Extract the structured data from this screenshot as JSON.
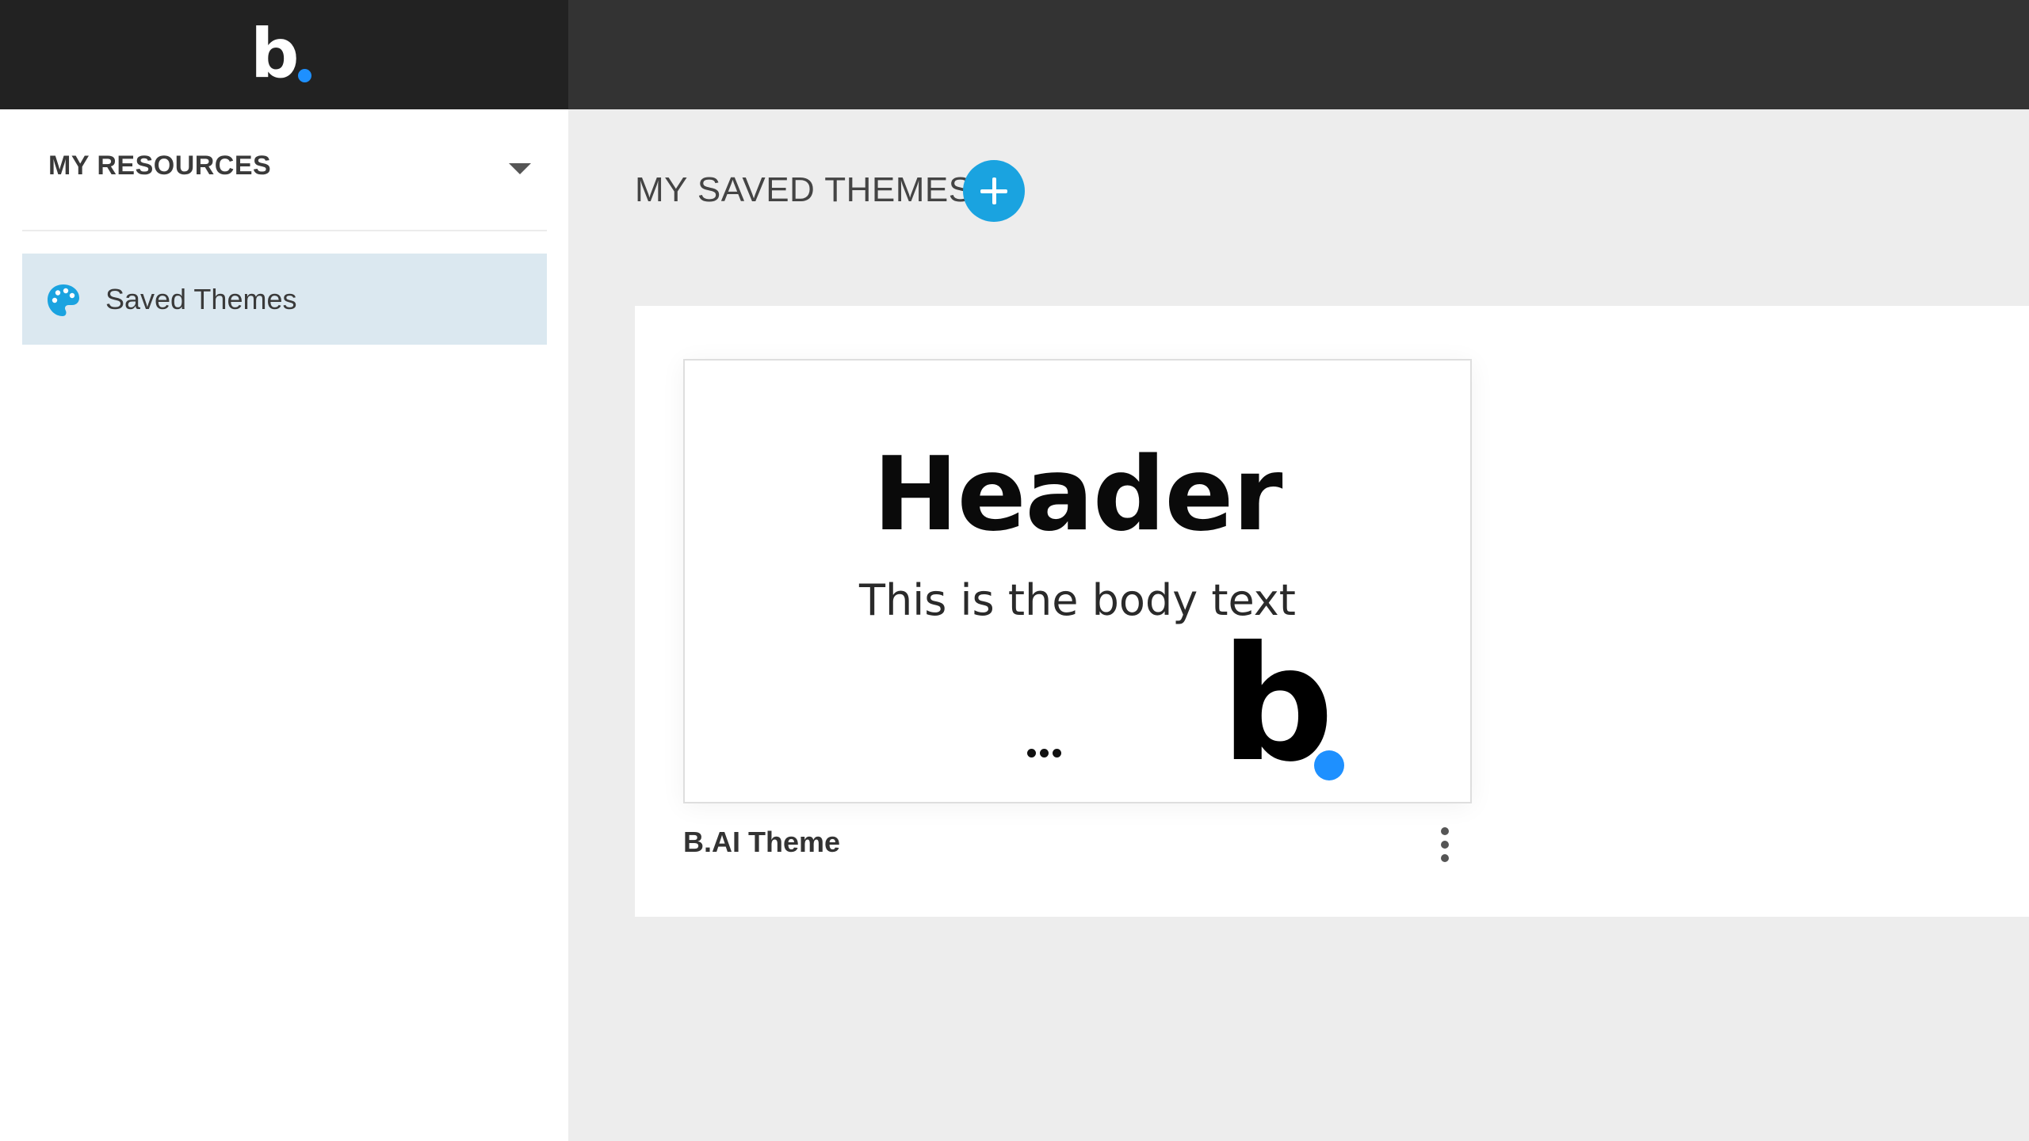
{
  "brand": {
    "logo_letter": "b.",
    "accent_color": "#1e90ff"
  },
  "sidebar": {
    "title": "MY RESOURCES",
    "items": [
      {
        "label": "Saved Themes",
        "icon": "palette-icon",
        "active": true
      }
    ]
  },
  "main": {
    "title": "MY SAVED THEMES",
    "add_button_icon": "plus-icon",
    "themes": [
      {
        "name": "B.AI Theme",
        "preview": {
          "header": "Header",
          "body": "This is the body text",
          "logo_letter": "b."
        },
        "menu_icon": "kebab-menu-icon"
      }
    ]
  },
  "colors": {
    "topbar": "#333333",
    "topbar_logo_area": "#222222",
    "active_item_bg": "#dbe8f0",
    "add_button": "#1aa3e0"
  }
}
